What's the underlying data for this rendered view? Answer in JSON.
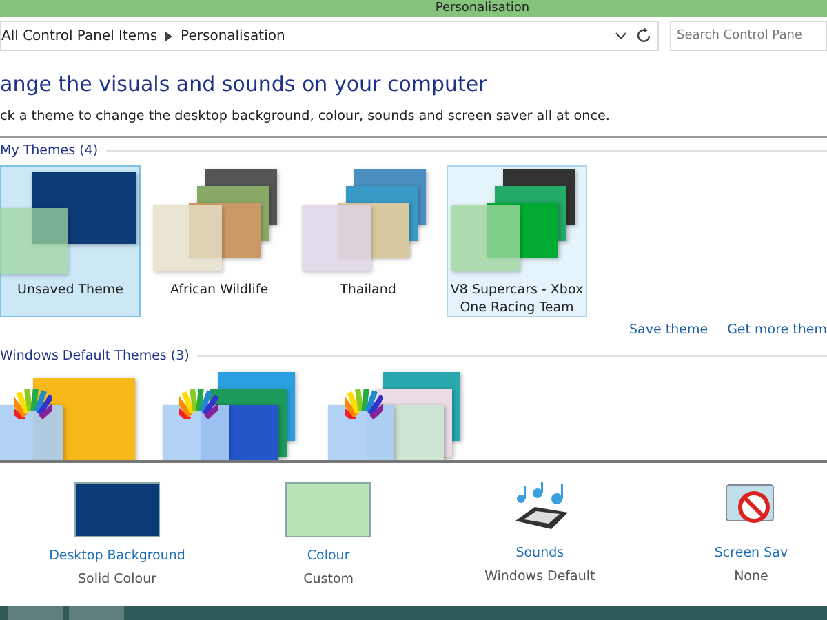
{
  "window": {
    "title": "Personalisation"
  },
  "address_bar": {
    "crumbs": [
      "All Control Panel Items",
      "Personalisation"
    ]
  },
  "search": {
    "placeholder": "Search Control Pane"
  },
  "heading": "ange the visuals and sounds on your computer",
  "description": "ck a theme to change the desktop background, colour, sounds and screen saver all at once.",
  "my_themes": {
    "title": "My Themes (4)",
    "themes": [
      {
        "name": "Unsaved Theme",
        "selected": true,
        "hover": false,
        "kind": "solid"
      },
      {
        "name": "African Wildlife",
        "selected": false,
        "hover": false,
        "kind": "stack"
      },
      {
        "name": "Thailand",
        "selected": false,
        "hover": false,
        "kind": "stack"
      },
      {
        "name": "V8 Supercars - Xbox One Racing Team",
        "selected": false,
        "hover": true,
        "kind": "stack"
      }
    ]
  },
  "links": [
    "Save theme",
    "Get more them"
  ],
  "default_themes": {
    "title": "Windows Default Themes (3)",
    "themes": [
      {
        "kind": "single"
      },
      {
        "kind": "stack"
      },
      {
        "kind": "stack"
      }
    ]
  },
  "settings": [
    {
      "kind": "background",
      "label": "Desktop Background",
      "value": "Solid Colour"
    },
    {
      "kind": "colour",
      "label": "Colour",
      "value": "Custom"
    },
    {
      "kind": "sounds",
      "label": "Sounds",
      "value": "Windows Default"
    },
    {
      "kind": "saver",
      "label": "Screen Sav",
      "value": "None"
    }
  ]
}
